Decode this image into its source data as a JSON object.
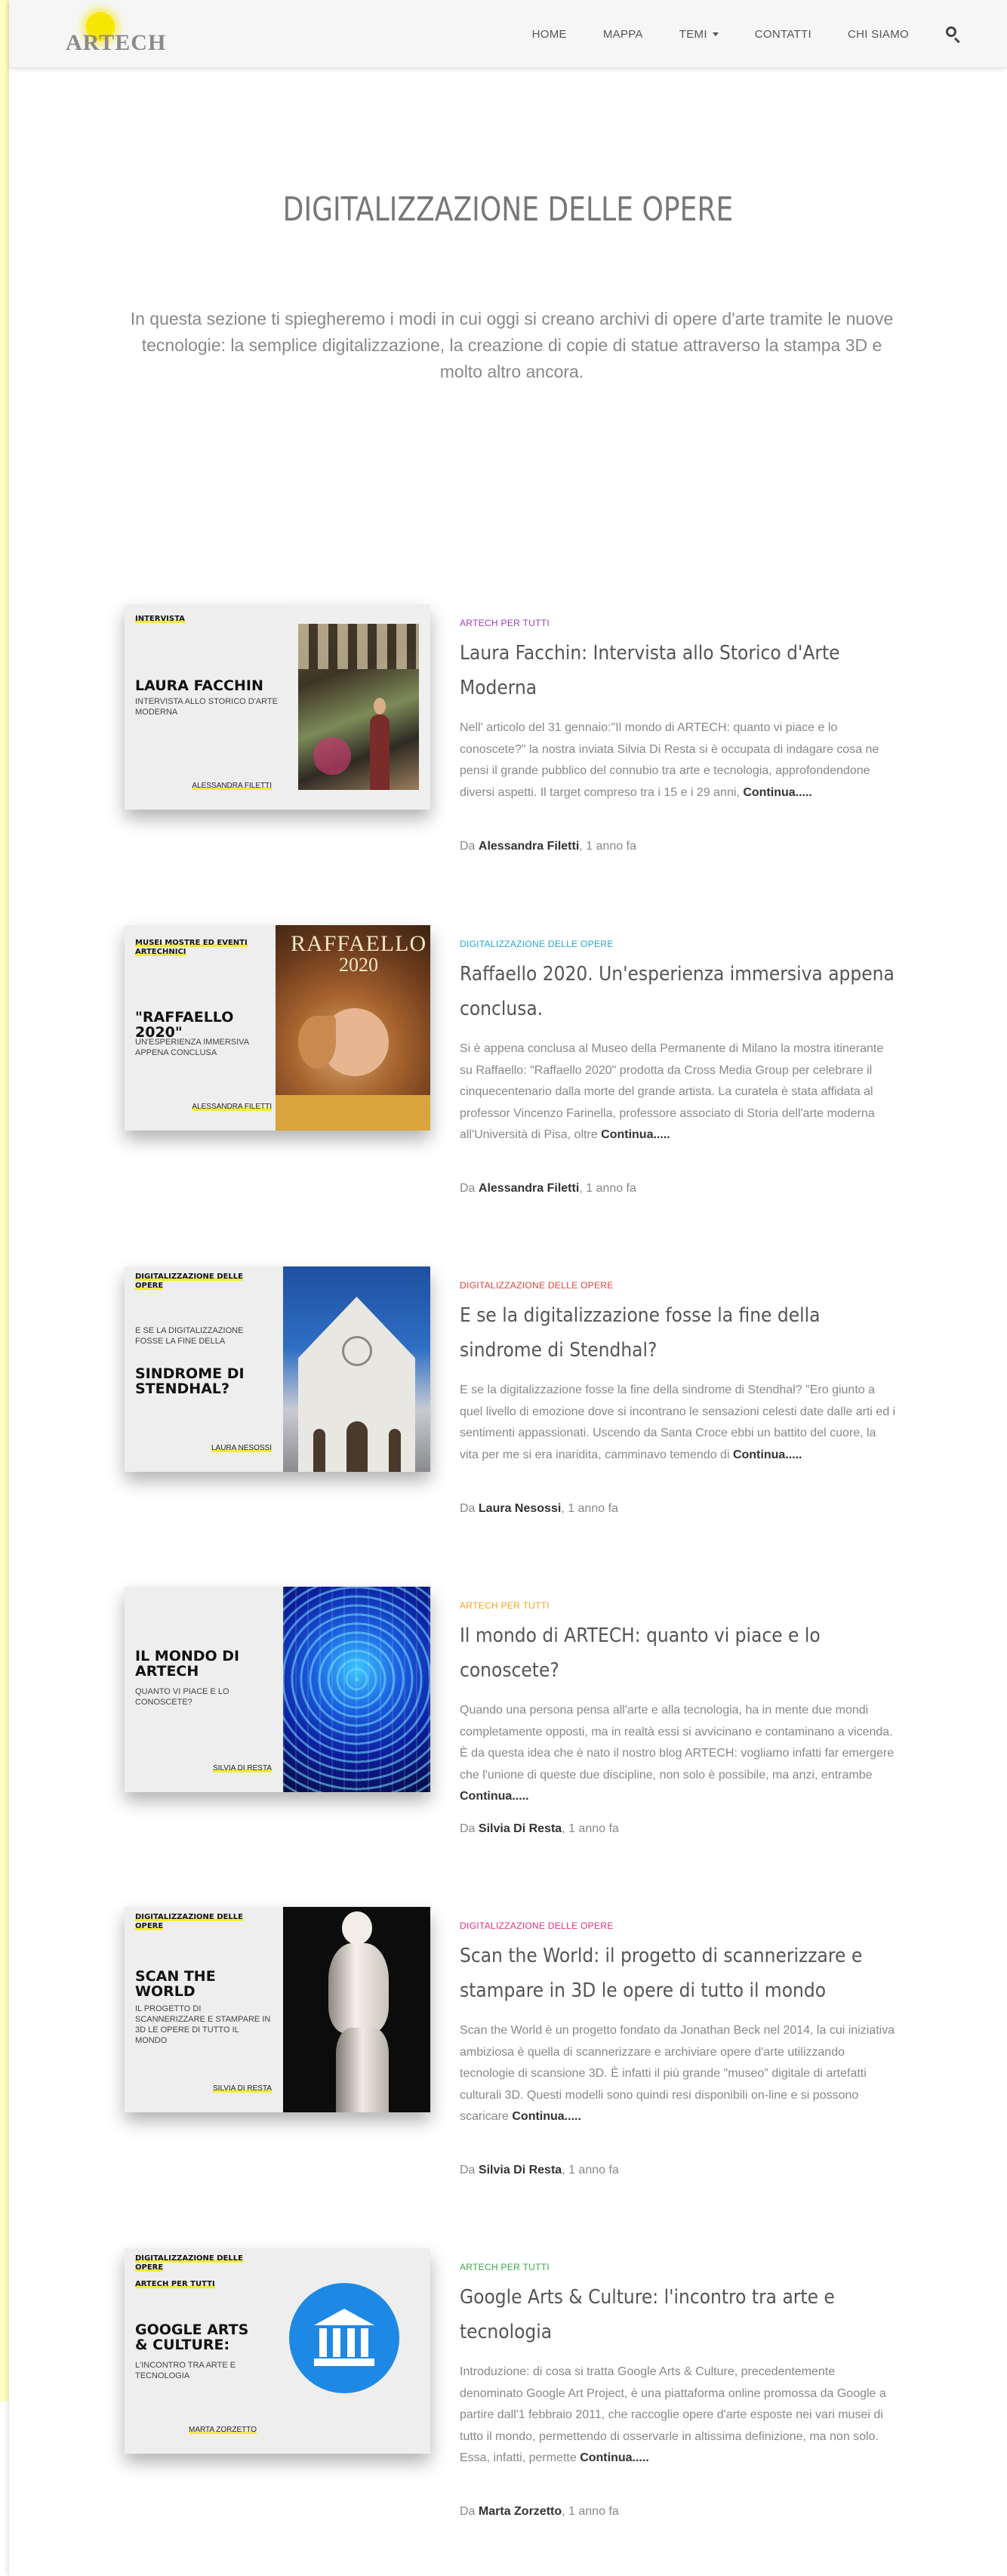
{
  "nav": {
    "logo_text": "ARTECH",
    "items": [
      "HOME",
      "MAPPA",
      "TEMI",
      "CONTATTI",
      "CHI SIAMO"
    ]
  },
  "hero": {
    "title": "DIGITALIZZAZIONE DELLE OPERE",
    "intro": "In questa sezione ti spiegheremo i modi in cui oggi si creano archivi di opere d'arte tramite le nuove tecnologie: la semplice digitalizzazione, la creazione di copie di statue attraverso la stampa 3D e molto altro ancora."
  },
  "posts": [
    {
      "thumb_tag": "INTERVISTA",
      "thumb_title": "LAURA FACCHIN",
      "thumb_sub": "INTERVISTA ALLO STORICO D'ARTE MODERNA",
      "thumb_author": "ALESSANDRA FILETTI",
      "category": "ARTECH PER TUTTI",
      "category_color": "#9b3bb5",
      "title": "Laura Facchin: Intervista allo Storico d'Arte Moderna",
      "excerpt": "Nell' articolo del 31 gennaio:\"Il mondo di ARTECH: quanto vi piace e lo conoscete?\" la nostra inviata Silvia Di Resta si è occupata di indagare cosa ne pensi il grande pubblico del connubio tra arte e tecnologia, approfondendone diversi aspetti. Il target compreso tra i 15 e i 29 anni,",
      "more": "Continua.....",
      "by": "Da",
      "author": "Alessandra Filetti",
      "time": ", 1 anno fa"
    },
    {
      "thumb_tag": "MUSEI MOSTRE ED EVENTI ARTECHNICI",
      "thumb_title": "\"RAFFAELLO 2020\"",
      "thumb_sub": "UN'ESPERIENZA IMMERSIVA APPENA CONCLUSA",
      "thumb_author": "ALESSANDRA FILETTI",
      "art_title": "RAFFAELLO",
      "art_year": "2020",
      "category": "DIGITALIZZAZIONE DELLE OPERE",
      "category_color": "#21a8c9",
      "title": "Raffaello 2020. Un'esperienza immersiva appena conclusa.",
      "excerpt": "Si è appena conclusa al Museo della Permanente di Milano la mostra itinerante su Raffaello: \"Raffaello 2020\" prodotta da Cross Media Group per celebrare il cinquecentenario dalla morte del grande artista.   La curatela è stata affidata al professor Vincenzo Farinella, professore associato di Storia dell'arte moderna all'Università di Pisa, oltre",
      "more": "Continua.....",
      "by": "Da",
      "author": "Alessandra Filetti",
      "time": ", 1 anno fa"
    },
    {
      "thumb_tag": "DIGITALIZZAZIONE DELLE OPERE",
      "thumb_title": "SINDROME DI STENDHAL?",
      "thumb_sub": "E SE LA DIGITALIZZAZIONE FOSSE LA FINE DELLA",
      "thumb_author": "LAURA NESOSSI",
      "category": "DIGITALIZZAZIONE DELLE OPERE",
      "category_color": "#e2413a",
      "title": "E se la digitalizzazione fosse la fine della sindrome di Stendhal?",
      "excerpt": "E se la digitalizzazione fosse la fine della sindrome di Stendhal? \"Ero giunto a quel livello di emozione dove si incontrano le sensazioni celesti date dalle arti ed i sentimenti appassionati. Uscendo da Santa Croce ebbi un battito del cuore, la vita per me si era inaridita, camminavo temendo di",
      "more": "Continua.....",
      "by": "Da",
      "author": "Laura Nesossi",
      "time": ", 1 anno fa"
    },
    {
      "thumb_tag": "",
      "thumb_title": "IL MONDO DI ARTECH",
      "thumb_sub": "QUANTO VI PIACE E LO CONOSCETE?",
      "thumb_author": "SILVIA DI RESTA",
      "category": "ARTECH PER TUTTI",
      "category_color": "#f5a21a",
      "title": "Il mondo di ARTECH: quanto vi piace e lo conoscete?",
      "excerpt": "Quando una persona pensa all'arte e alla tecnologia, ha in mente due mondi completamente opposti, ma in realtà essi si avvicinano e contaminano a vicenda. È da questa idea che è nato il nostro blog ARTECH: vogliamo infatti far emergere che l'unione di queste due discipline, non solo è possibile, ma anzi, entrambe",
      "more": "Continua.....",
      "by": "Da",
      "author": "Silvia Di Resta",
      "time": ", 1 anno fa"
    },
    {
      "thumb_tag": "DIGITALIZZAZIONE DELLE OPERE",
      "thumb_title": "SCAN THE WORLD",
      "thumb_sub": "IL PROGETTO DI SCANNERIZZARE E STAMPARE IN 3D LE OPERE DI TUTTO IL MONDO",
      "thumb_author": "SILVIA DI RESTA",
      "category": "DIGITALIZZAZIONE DELLE OPERE",
      "category_color": "#e0307a",
      "title": "Scan the World: il progetto di scannerizzare e stampare in 3D le opere di tutto il mondo",
      "excerpt": "Scan the World è un progetto fondato da Jonathan Beck nel 2014, la cui iniziativa ambiziosa è quella di scannerizzare e archiviare opere d'arte utilizzando tecnologie di scansione 3D. È infatti il più grande \"museo\" digitale di artefatti culturali 3D. Questi modelli sono quindi resi disponibili on-line e si possono scaricare",
      "more": "Continua.....",
      "by": "Da",
      "author": "Silvia Di Resta",
      "time": ", 1 anno fa"
    },
    {
      "thumb_tag": "DIGITALIZZAZIONE DELLE OPERE",
      "thumb_tag2": "ARTECH PER TUTTI",
      "thumb_title": "GOOGLE ARTS & CULTURE:",
      "thumb_sub": "L'INCONTRO TRA ARTE E TECNOLOGIA",
      "thumb_author": "MARTA ZORZETTO",
      "category": "ARTECH PER TUTTI",
      "category_color": "#3aa64a",
      "title": "Google Arts & Culture: l'incontro tra arte e tecnologia",
      "excerpt": "Introduzione: di cosa si tratta Google Arts & Culture, precedentemente denominato Google Art Project, è una piattaforma online promossa da Google a partire dall'1 febbraio 2011, che raccoglie opere d'arte esposte nei vari musei di tutto il mondo, permettendo di osservarle in altissima definizione, ma non solo. Essa, infatti, permette",
      "more": "Continua.....",
      "by": "Da",
      "author": "Marta Zorzetto",
      "time": ", 1 anno fa"
    }
  ]
}
